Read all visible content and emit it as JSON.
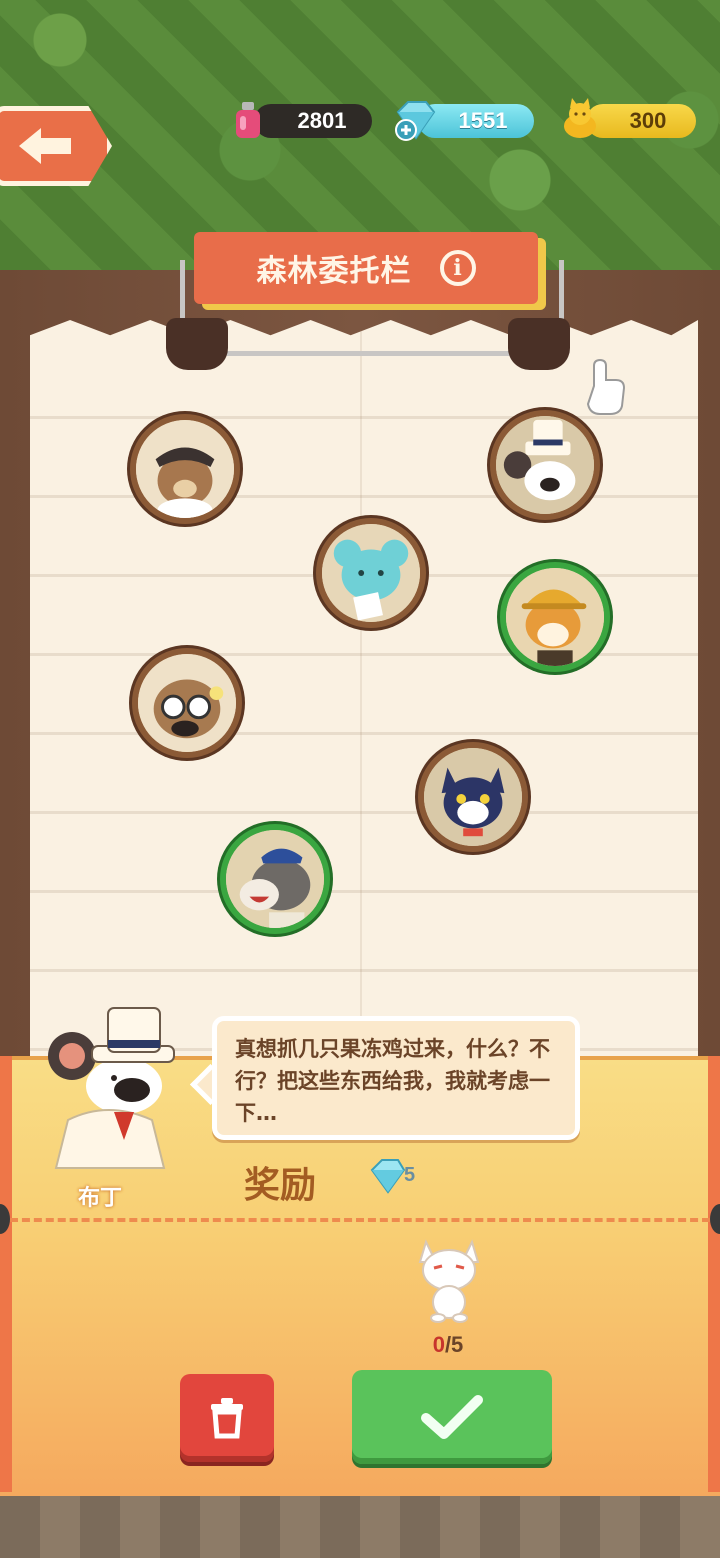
{
  "currency": {
    "ink": "2801",
    "gems": "1551",
    "gold": "300"
  },
  "title": {
    "text": "森林委托栏",
    "info_glyph": "i"
  },
  "clients": [
    {
      "name": "bear-avatar",
      "highlight": false
    },
    {
      "name": "mouse-top-hat-avatar",
      "highlight": false
    },
    {
      "name": "blue-koala-avatar",
      "highlight": false
    },
    {
      "name": "shiba-explorer-avatar",
      "highlight": true
    },
    {
      "name": "owl-glasses-avatar",
      "highlight": false
    },
    {
      "name": "black-cat-avatar",
      "highlight": false
    },
    {
      "name": "donkey-avatar",
      "highlight": true
    }
  ],
  "request": {
    "npc_name": "布丁",
    "dialog": "真想抓几只果冻鸡过来，什么？不行？把这些东西给我，我就考虑一下…",
    "reward_label": "奖励",
    "reward_gems": "5",
    "item_progress_current": "0",
    "item_progress_total": "/5"
  },
  "colors": {
    "accent_orange": "#e86d4a",
    "gem_blue": "#4cc3d8",
    "gold": "#f8d84a",
    "confirm_green": "#5ac35b",
    "delete_red": "#e2463d"
  },
  "icons": {
    "back": "back-arrow-icon",
    "delete": "trash-icon",
    "confirm": "checkmark-icon"
  }
}
